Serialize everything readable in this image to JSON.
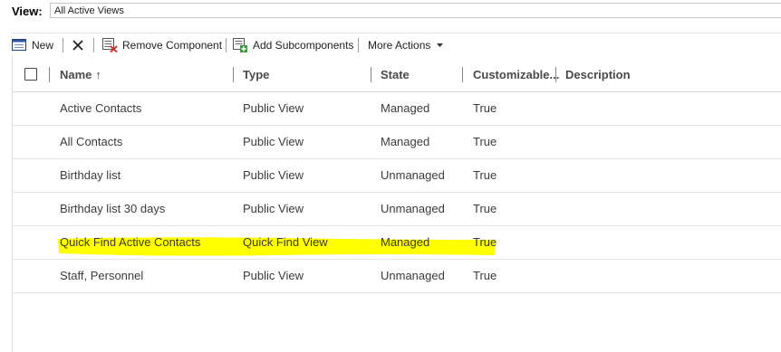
{
  "view": {
    "label": "View:",
    "value": "All Active Views"
  },
  "toolbar": {
    "new_label": "New",
    "remove_label": "Remove Component",
    "add_label": "Add Subcomponents",
    "more_label": "More Actions"
  },
  "columns": {
    "name": "Name",
    "sort_indicator": "↑",
    "type": "Type",
    "state": "State",
    "customizable": "Customizable...",
    "description": "Description"
  },
  "rows": [
    {
      "name": "Active Contacts",
      "type": "Public View",
      "state": "Managed",
      "customizable": "True",
      "description": ""
    },
    {
      "name": "All Contacts",
      "type": "Public View",
      "state": "Managed",
      "customizable": "True",
      "description": ""
    },
    {
      "name": "Birthday list",
      "type": "Public View",
      "state": "Unmanaged",
      "customizable": "True",
      "description": ""
    },
    {
      "name": "Birthday list 30 days",
      "type": "Public View",
      "state": "Unmanaged",
      "customizable": "True",
      "description": ""
    },
    {
      "name": "Quick Find Active Contacts",
      "type": "Quick Find View",
      "state": "Managed",
      "customizable": "True",
      "description": "",
      "highlighted": true
    },
    {
      "name": "Staff, Personnel",
      "type": "Public View",
      "state": "Unmanaged",
      "customizable": "True",
      "description": ""
    }
  ],
  "icons": {
    "new": "new-record-icon",
    "delete": "delete-x-icon",
    "remove": "remove-component-icon",
    "add": "add-subcomponents-icon",
    "more": "chevron-down-icon"
  },
  "colors": {
    "highlight": "#ffff00",
    "header_text": "#4a4a4a",
    "row_text": "#3b3b3b"
  }
}
